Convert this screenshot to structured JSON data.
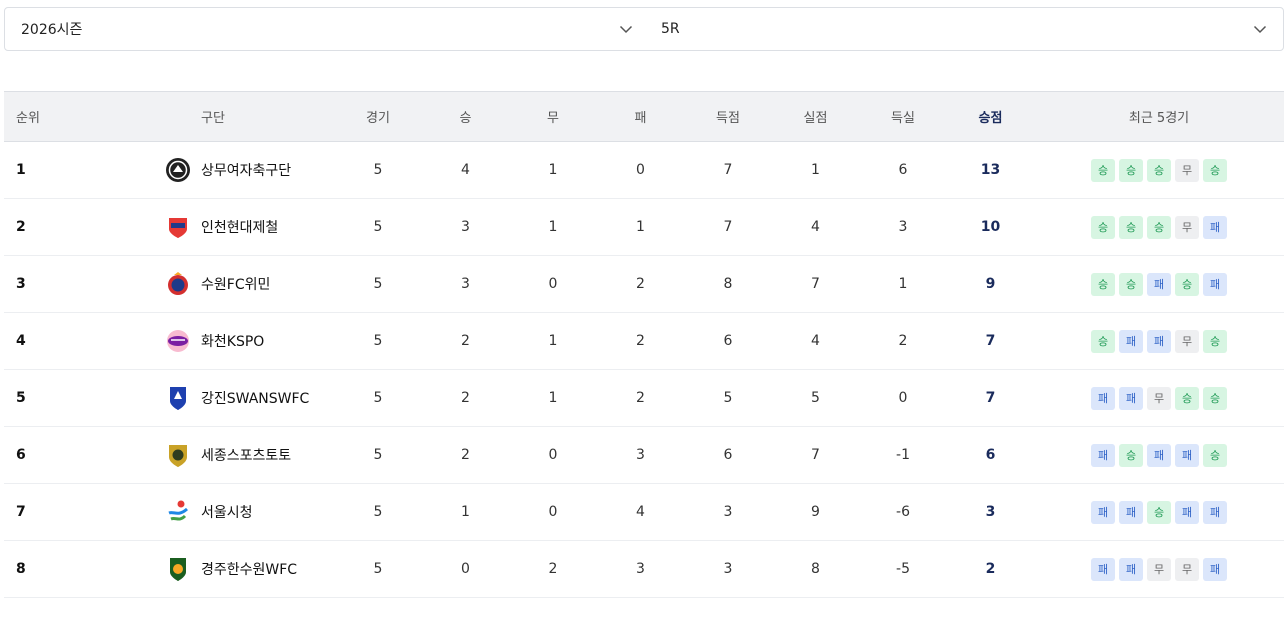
{
  "filters": {
    "season": "2026시즌",
    "round": "5R"
  },
  "table": {
    "headers": {
      "rank": "순위",
      "club": "구단",
      "played": "경기",
      "wins": "승",
      "draws": "무",
      "losses": "패",
      "goals_for": "득점",
      "goals_against": "실점",
      "goal_diff": "득실",
      "points": "승점",
      "recent": "최근 5경기"
    },
    "rows": [
      {
        "rank": "1",
        "club": "상무여자축구단",
        "logo": "sangmu-logo",
        "played": "5",
        "wins": "4",
        "draws": "1",
        "losses": "0",
        "gf": "7",
        "ga": "1",
        "gd": "6",
        "pts": "13",
        "recent": [
          "승",
          "승",
          "승",
          "무",
          "승"
        ]
      },
      {
        "rank": "2",
        "club": "인천현대제철",
        "logo": "incheon-logo",
        "played": "5",
        "wins": "3",
        "draws": "1",
        "losses": "1",
        "gf": "7",
        "ga": "4",
        "gd": "3",
        "pts": "10",
        "recent": [
          "승",
          "승",
          "승",
          "무",
          "패"
        ]
      },
      {
        "rank": "3",
        "club": "수원FC위민",
        "logo": "suwon-fc-logo",
        "played": "5",
        "wins": "3",
        "draws": "0",
        "losses": "2",
        "gf": "8",
        "ga": "7",
        "gd": "1",
        "pts": "9",
        "recent": [
          "승",
          "승",
          "패",
          "승",
          "패"
        ]
      },
      {
        "rank": "4",
        "club": "화천KSPO",
        "logo": "hwacheon-logo",
        "played": "5",
        "wins": "2",
        "draws": "1",
        "losses": "2",
        "gf": "6",
        "ga": "4",
        "gd": "2",
        "pts": "7",
        "recent": [
          "승",
          "패",
          "패",
          "무",
          "승"
        ]
      },
      {
        "rank": "5",
        "club": "강진SWANSWFC",
        "logo": "gangjin-logo",
        "played": "5",
        "wins": "2",
        "draws": "1",
        "losses": "2",
        "gf": "5",
        "ga": "5",
        "gd": "0",
        "pts": "7",
        "recent": [
          "패",
          "패",
          "무",
          "승",
          "승"
        ]
      },
      {
        "rank": "6",
        "club": "세종스포츠토토",
        "logo": "sejong-logo",
        "played": "5",
        "wins": "2",
        "draws": "0",
        "losses": "3",
        "gf": "6",
        "ga": "7",
        "gd": "-1",
        "pts": "6",
        "recent": [
          "패",
          "승",
          "패",
          "패",
          "승"
        ]
      },
      {
        "rank": "7",
        "club": "서울시청",
        "logo": "seoul-logo",
        "played": "5",
        "wins": "1",
        "draws": "0",
        "losses": "4",
        "gf": "3",
        "ga": "9",
        "gd": "-6",
        "pts": "3",
        "recent": [
          "패",
          "패",
          "승",
          "패",
          "패"
        ]
      },
      {
        "rank": "8",
        "club": "경주한수원WFC",
        "logo": "gyeongju-logo",
        "played": "5",
        "wins": "0",
        "draws": "2",
        "losses": "3",
        "gf": "3",
        "ga": "8",
        "gd": "-5",
        "pts": "2",
        "recent": [
          "패",
          "패",
          "무",
          "무",
          "패"
        ]
      }
    ]
  },
  "colors": {
    "win": "#1f9a55",
    "loss": "#2f63c7",
    "draw": "#666666",
    "points": "#1a2b5c"
  }
}
